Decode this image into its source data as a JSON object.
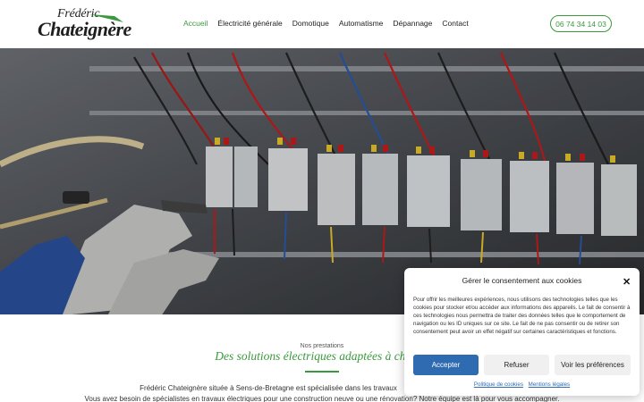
{
  "header": {
    "logo_line1": "Frédéric",
    "logo_line2": "Chateignère",
    "nav": [
      {
        "label": "Accueil",
        "active": true
      },
      {
        "label": "Électricité générale",
        "active": false
      },
      {
        "label": "Domotique",
        "active": false
      },
      {
        "label": "Automatisme",
        "active": false
      },
      {
        "label": "Dépannage",
        "active": false
      },
      {
        "label": "Contact",
        "active": false
      }
    ],
    "phone": "06 74 34 14 03"
  },
  "section": {
    "eyebrow": "Nos prestations",
    "title": "Des solutions électriques adaptées à chaque",
    "paragraph1": "Frédéric Chateignère située à  Sens-de-Bretagne est spécialisée dans les travaux",
    "paragraph2": "Vous avez besoin de spécialistes en travaux électriques pour une construction neuve ou une rénovation? Notre équipe est là pour vous accompagner."
  },
  "cookie": {
    "title": "Gérer le consentement aux cookies",
    "text": "Pour offrir les meilleures expériences, nous utilisons des technologies telles que les cookies pour stocker et/ou accéder aux informations des appareils. Le fait de consentir à ces technologies nous permettra de traiter des données telles que le comportement de navigation ou les ID uniques sur ce site. Le fait de ne pas consentir ou de retirer son consentement peut avoir un effet négatif sur certaines caractéristiques et fonctions.",
    "accept_label": "Accepter",
    "refuse_label": "Refuser",
    "prefs_label": "Voir les préférences",
    "link_policy": "Politique de cookies",
    "link_legal": "Mentions légales"
  },
  "colors": {
    "accent_green": "#3a9a3d",
    "accept_blue": "#2f6bb1"
  }
}
